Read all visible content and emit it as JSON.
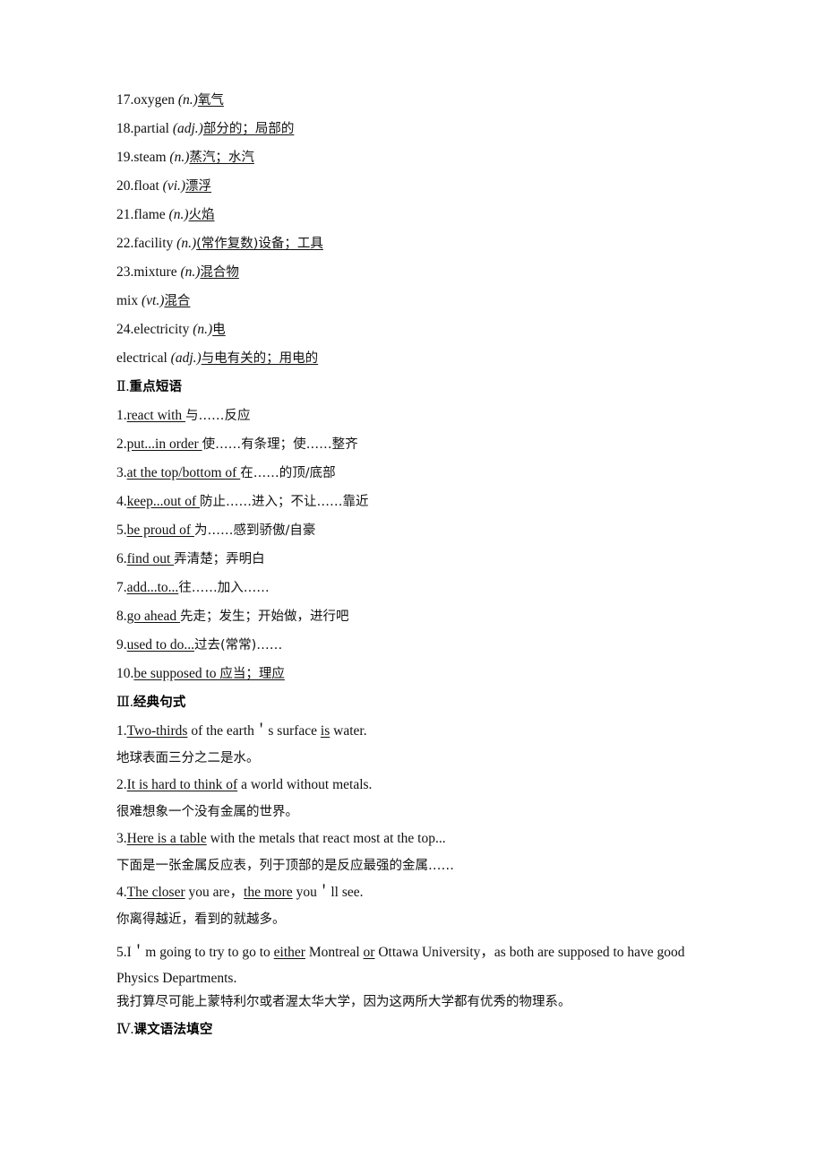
{
  "page": {
    "background": "#ffffff",
    "text_color": "#111111"
  },
  "vocabulary": {
    "items": [
      {
        "num": "17.",
        "word": "oxygen ",
        "pos": "(n.)",
        "cn": "氧气"
      },
      {
        "num": "18.",
        "word": "partial ",
        "pos": "(adj.)",
        "cn": "部分的；局部的"
      },
      {
        "num": "19.",
        "word": "steam ",
        "pos": "(n.)",
        "cn": "蒸汽；水汽"
      },
      {
        "num": "20.",
        "word": "float ",
        "pos": "(vi.)",
        "cn": "漂浮"
      },
      {
        "num": "21.",
        "word": "flame ",
        "pos": "(n.)",
        "cn": "火焰"
      },
      {
        "num": "22.",
        "word": "facility ",
        "pos": "(n.)",
        "cn": "(常作复数)设备；工具"
      },
      {
        "num": "23.",
        "word": "mixture ",
        "pos": "(n.)",
        "cn": "混合物"
      },
      {
        "num": "",
        "word": "mix ",
        "pos": "(vt.)",
        "cn": "混合"
      },
      {
        "num": "24.",
        "word": "electricity ",
        "pos": "(n.)",
        "cn": "电"
      },
      {
        "num": "",
        "word": "electrical ",
        "pos": "(adj.)",
        "cn": "与电有关的；用电的"
      }
    ]
  },
  "phrases_section": {
    "heading_numeral": "Ⅱ.",
    "heading_label": "重点短语",
    "items": [
      {
        "num": "1.",
        "en": "react with ",
        "cn": "与……反应"
      },
      {
        "num": "2.",
        "en": "put...in order ",
        "cn": "使……有条理；使……整齐"
      },
      {
        "num": "3.",
        "en": "at the top/bottom of ",
        "cn": "在……的顶/底部"
      },
      {
        "num": "4.",
        "en": "keep...out of ",
        "cn": "防止……进入；不让……靠近"
      },
      {
        "num": "5.",
        "en": "be proud of ",
        "cn": "为……感到骄傲/自豪"
      },
      {
        "num": "6.",
        "en": "find out ",
        "cn": "弄清楚；弄明白"
      },
      {
        "num": "7.",
        "en": "add...to...",
        "cn": "往……加入……"
      },
      {
        "num": "8.",
        "en": "go ahead ",
        "cn": "先走；发生；开始做，进行吧"
      },
      {
        "num": "9.",
        "en": "used to do...",
        "cn": "过去(常常)……"
      },
      {
        "num": "10.",
        "en": "be supposed to ",
        "cn": "应当；理应",
        "cn_underlined": true
      }
    ]
  },
  "sentences_section": {
    "heading_numeral": "Ⅲ.",
    "heading_label": "经典句式",
    "items": [
      {
        "num": "1.",
        "en_pre_underline": "Two-thirds",
        "en_mid": " of the earth＇s surface ",
        "en_underline2": "is",
        "en_post": " water.",
        "cn": "地球表面三分之二是水。"
      },
      {
        "num": "2.",
        "en_pre_underline": "It is hard to think of",
        "en_mid": " a world without metals.",
        "en_underline2": "",
        "en_post": "",
        "cn": "很难想象一个没有金属的世界。"
      },
      {
        "num": "3.",
        "en_pre_underline": "Here is a table",
        "en_mid": " with the metals that react most at the top...",
        "en_underline2": "",
        "en_post": "",
        "cn": "下面是一张金属反应表，列于顶部的是反应最强的金属……"
      },
      {
        "num": "4.",
        "en_pre_underline": "The closer",
        "en_mid": " you are，",
        "en_underline2": "the more",
        "en_post": " you＇ll see.",
        "cn": "你离得越近，看到的就越多。"
      }
    ],
    "item5": {
      "num": "5.",
      "part1": "I＇m going to try to go to ",
      "underline1": "either",
      "part2": " Montreal ",
      "underline2": "or",
      "part3": " Ottawa University，as both are supposed to have good Physics Departments.",
      "cn": "我打算尽可能上蒙特利尔或者渥太华大学，因为这两所大学都有优秀的物理系。"
    }
  },
  "grammar_section": {
    "heading_numeral": "Ⅳ.",
    "heading_label": "课文语法填空"
  }
}
